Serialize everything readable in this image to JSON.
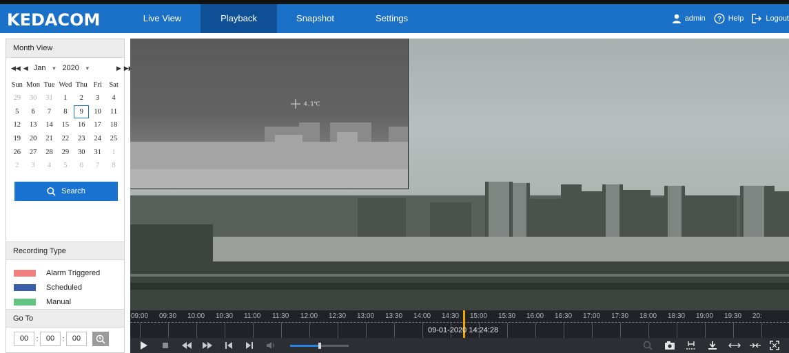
{
  "app": {
    "logo": "KEDACOM"
  },
  "nav": {
    "items": [
      {
        "label": "Live View"
      },
      {
        "label": "Playback"
      },
      {
        "label": "Snapshot"
      },
      {
        "label": "Settings"
      }
    ],
    "active": "Playback"
  },
  "user": {
    "name": "admin",
    "help_label": "Help",
    "logout_label": "Logout"
  },
  "month_view": {
    "title": "Month View",
    "month": "Jan",
    "year": "2020",
    "weekdays": [
      "Sun",
      "Mon",
      "Tue",
      "Wed",
      "Thu",
      "Fri",
      "Sat"
    ],
    "weeks": [
      [
        "29",
        "30",
        "31",
        "1",
        "2",
        "3",
        "4"
      ],
      [
        "5",
        "6",
        "7",
        "8",
        "9",
        "10",
        "11"
      ],
      [
        "12",
        "13",
        "14",
        "15",
        "16",
        "17",
        "18"
      ],
      [
        "19",
        "20",
        "21",
        "22",
        "23",
        "24",
        "25"
      ],
      [
        "26",
        "27",
        "28",
        "29",
        "30",
        "31",
        "1"
      ],
      [
        "2",
        "3",
        "4",
        "5",
        "6",
        "7",
        "8"
      ]
    ],
    "selected_day": "9",
    "search_label": "Search"
  },
  "recording_type": {
    "title": "Recording Type",
    "items": [
      {
        "label": "Alarm Triggered",
        "color": "#f08080"
      },
      {
        "label": "Scheduled",
        "color": "#3a5ea8"
      },
      {
        "label": "Manual",
        "color": "#66c483"
      }
    ]
  },
  "goto": {
    "title": "Go To",
    "hour": "00",
    "minute": "00",
    "second": "00"
  },
  "video": {
    "thermal_readout": "4.1℃"
  },
  "timeline": {
    "labels": [
      "09:00",
      "09:30",
      "10:00",
      "10:30",
      "11:00",
      "11:30",
      "12:00",
      "12:30",
      "13:00",
      "13:30",
      "14:00",
      "14:30",
      "15:00",
      "15:30",
      "16:00",
      "16:30",
      "17:00",
      "17:30",
      "18:00",
      "18:30",
      "19:00",
      "19:30",
      "20:"
    ],
    "current": "09-01-2020 14:24:28"
  },
  "controls": {
    "volume_level": 0.5
  },
  "colors": {
    "header": "#1a6fc7",
    "nav_active": "#0f4f96",
    "search_button": "#1a73d1",
    "timeline_cursor": "#f0a400"
  }
}
